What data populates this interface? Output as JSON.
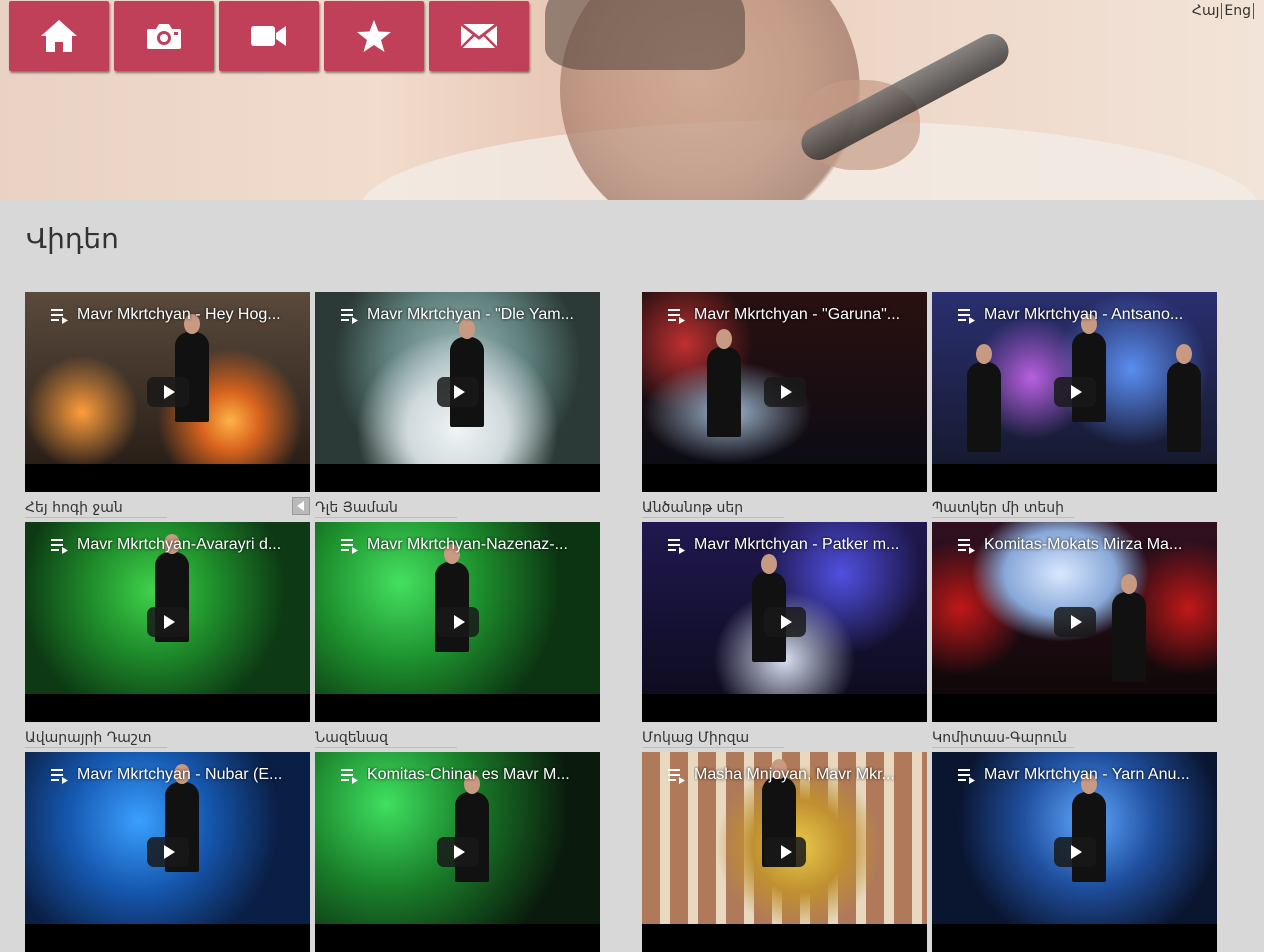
{
  "nav": {
    "items": [
      {
        "name": "home",
        "icon": "home-icon"
      },
      {
        "name": "photos",
        "icon": "camera-icon"
      },
      {
        "name": "videos",
        "icon": "video-camera-icon"
      },
      {
        "name": "favorites",
        "icon": "star-icon"
      },
      {
        "name": "contact",
        "icon": "envelope-icon"
      }
    ],
    "color": "#c0405a"
  },
  "language": {
    "armenian": "Հայ",
    "english": "Eng"
  },
  "page": {
    "title": "Վիդեո"
  },
  "videos": [
    {
      "title": "Mavr Mkrtchyan - Hey Hog...",
      "caption": "Հեյ հոգի ջան"
    },
    {
      "title": "Mavr Mkrtchyan - \"Dle Yam...",
      "caption": "Դլե Յաման"
    },
    {
      "title": "Mavr Mkrtchyan - \"Garuna\"...",
      "caption": "Անծանոթ սեր"
    },
    {
      "title": "Mavr Mkrtchyan - Antsano...",
      "caption": "Պատկեր մի տեսի"
    },
    {
      "title": "Mavr Mkrtchyan-Avarayri d...",
      "caption": "Ավարայրի Դաշտ"
    },
    {
      "title": "Mavr Mkrtchyan-Nazenaz-...",
      "caption": "Նազենազ"
    },
    {
      "title": "Mavr Mkrtchyan - Patker m...",
      "caption": "Մոկաց Միրզա"
    },
    {
      "title": "Komitas-Mokats Mirza Ma...",
      "caption": "Կոմիտաս-Գարուն"
    },
    {
      "title": "Mavr Mkrtchyan - Nubar (E...",
      "caption": ""
    },
    {
      "title": "Komitas-Chinar es Mavr M...",
      "caption": ""
    },
    {
      "title": "Masha Mnjoyan, Mavr Mkr...",
      "caption": ""
    },
    {
      "title": "Mavr Mkrtchyan - Yarn Anu...",
      "caption": ""
    }
  ]
}
